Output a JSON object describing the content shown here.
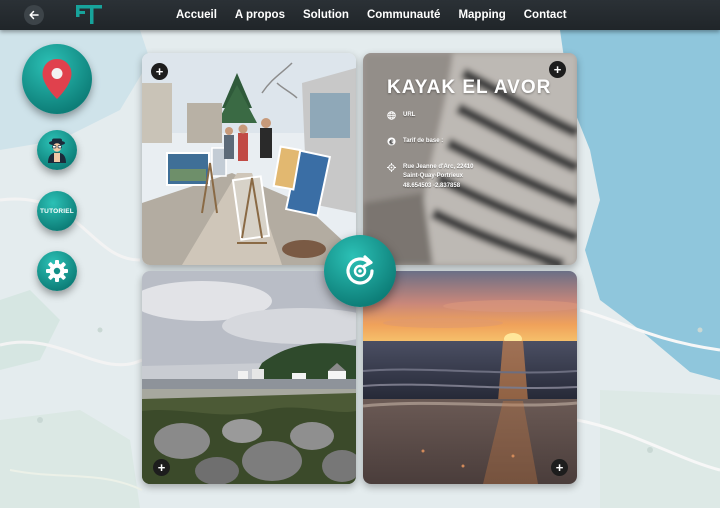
{
  "nav": {
    "back_icon": "arrow-left-icon",
    "logo_icon": "ft-logo-icon",
    "items": [
      {
        "label": "Accueil"
      },
      {
        "label": "A propos"
      },
      {
        "label": "Solution"
      },
      {
        "label": "Communauté"
      },
      {
        "label": "Mapping"
      },
      {
        "label": "Contact"
      }
    ]
  },
  "sidebar": {
    "location_icon": "map-pin-icon",
    "guide_icon": "explorer-avatar-icon",
    "tutoriel_label": "TUTORIEL",
    "settings_icon": "gear-icon"
  },
  "info_card": {
    "title": "KAYAK EL AVOR",
    "url_label": "URL",
    "tarif_label": "Tarif de base :",
    "address_line1": "Rue Jeanne d'Arc, 22410",
    "address_line2": "Saint-Quay-Portrieux",
    "coordinates": "48.654503 -2.837858"
  },
  "cards": {
    "plus_symbol": "+",
    "market_image": "art-market-street-photo",
    "info_background": "blurred-striped-clothing-photo",
    "beach_image": "rocky-beach-cloudy-photo",
    "sunset_image": "sunset-over-sea-photo"
  },
  "refresh_icon": "refresh-eye-icon",
  "colors": {
    "accent": "#17a39b",
    "nav_bg": "#23282c",
    "sea": "#8fc6dc"
  }
}
